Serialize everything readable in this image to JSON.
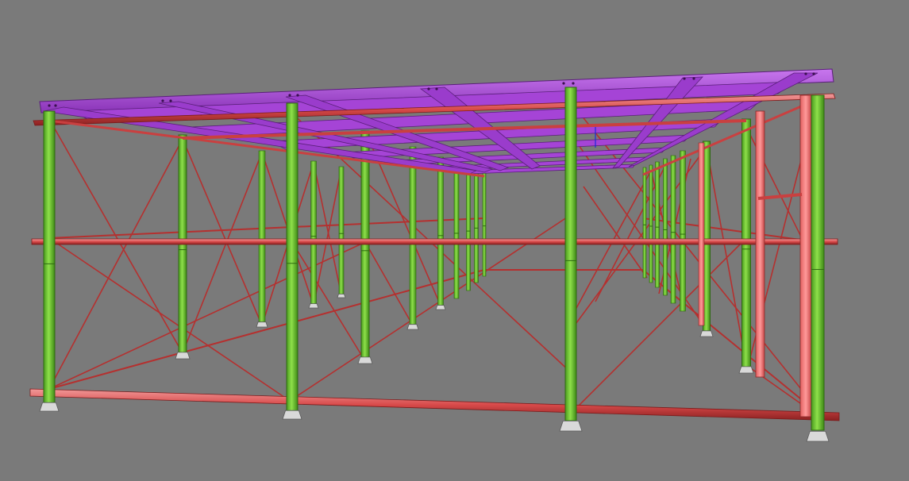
{
  "scene": {
    "background": "#7a7a7a",
    "colors": {
      "column": "#7fd23a",
      "column_edge": "#2f6a12",
      "beam_purple": "#b14de0",
      "beam_purple_edge": "#5a1f7a",
      "tube_red": "#d84a4a",
      "tube_red_edge": "#7a1c1c",
      "tube_highlight": "#f08a8a",
      "pink_post": "#f07a7a",
      "base_plate": "#d9d9d9",
      "brace": "#b5302f"
    },
    "structure_type": "steel shoring frame — 3D model",
    "column_lines": 4,
    "tiers": 2
  }
}
